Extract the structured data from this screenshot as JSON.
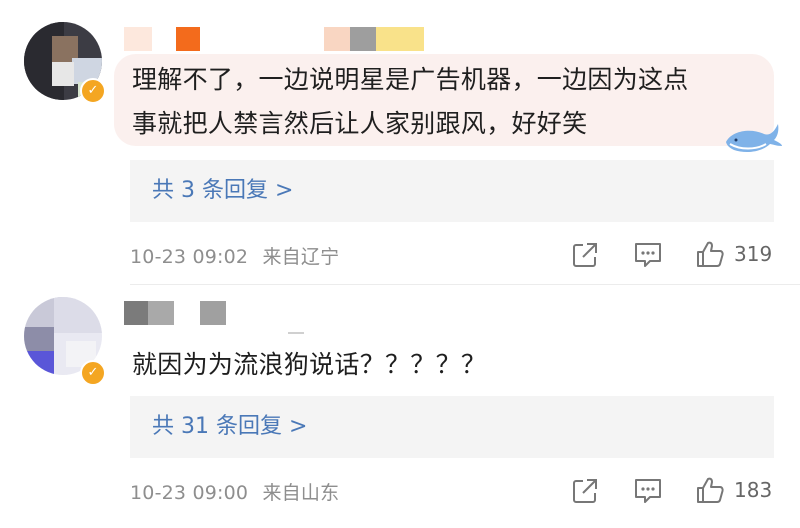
{
  "comments": [
    {
      "text_line1": "理解不了，一边说明星是广告机器，一边因为这点",
      "text_line2": "事就把人禁言然后让人家别跟风，好好笑",
      "replies_label": "共 3 条回复 >",
      "time": "10-23 09:02",
      "location": "来自辽宁",
      "likes": "319"
    },
    {
      "text_line1": "就因为为流浪狗说话？？？？？",
      "replies_label": "共 31 条回复 >",
      "time": "10-23 09:00",
      "location": "来自山东",
      "likes": "183"
    }
  ],
  "icons": {
    "share": "share-icon",
    "comment": "comment-icon",
    "like": "thumbs-up-icon",
    "verified": "verified-badge-icon"
  },
  "colors": {
    "bubble_bg": "#fbf0ee",
    "reply_box_bg": "#f4f4f4",
    "reply_link": "#4a78b7",
    "meta_text": "#8e8e8e",
    "verified_badge": "#f4a622"
  }
}
